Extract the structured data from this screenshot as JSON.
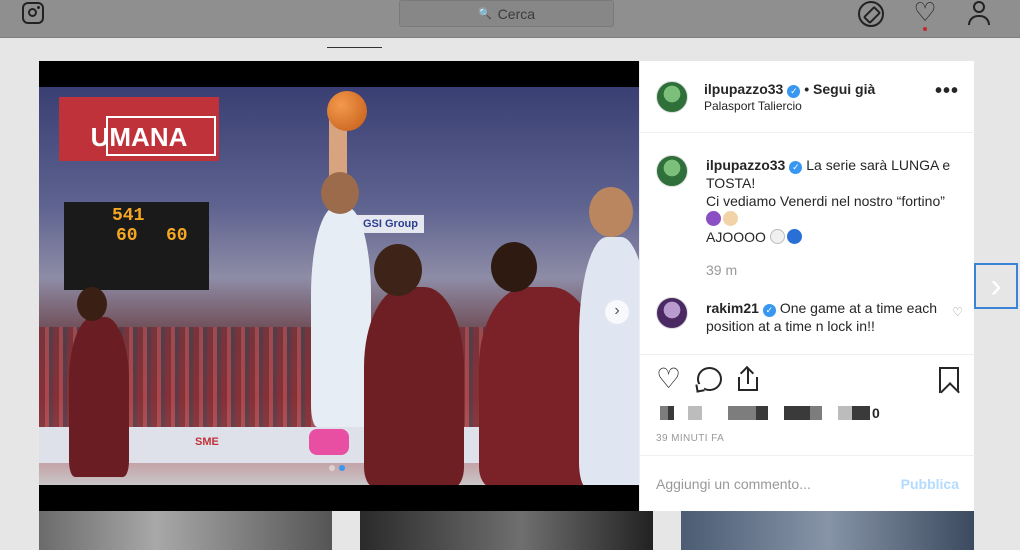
{
  "nav": {
    "search_placeholder": "Cerca",
    "icons": [
      "instagram-glyph-icon",
      "search-icon",
      "explore-compass-icon",
      "activity-heart-icon",
      "profile-icon"
    ]
  },
  "post": {
    "username": "ilpupazzo33",
    "follow_text": "• Segui già",
    "location": "Palasport Taliercio",
    "more": "•••",
    "caption_user": "ilpupazzo33",
    "caption_line1": " La serie sarà LUNGA e TOSTA!",
    "caption_line2": "Ci vediamo Venerdi nel nostro “fortino”",
    "caption_line4": "AJOOOO",
    "caption_time": "39 m",
    "comments": [
      {
        "user": "rakim21",
        "text": " One game at a time each position at a time n lock in!!"
      }
    ],
    "likes_suffix": "0",
    "posted_ago": "39 MINUTI FA",
    "add_comment_placeholder": "Aggiungi un commento...",
    "publish_label": "Pubblica"
  },
  "media": {
    "banner": "UMANA",
    "score_left": "541",
    "score_mid": "60",
    "score_right": "60",
    "sponsor1": "GSI Group",
    "sponsor2": "SME",
    "carousel_index": 2,
    "carousel_total": 2
  },
  "colors": {
    "verified": "#3897f0",
    "publish_disabled": "#b3dbff",
    "next_post_outline": "#3b83d6"
  }
}
